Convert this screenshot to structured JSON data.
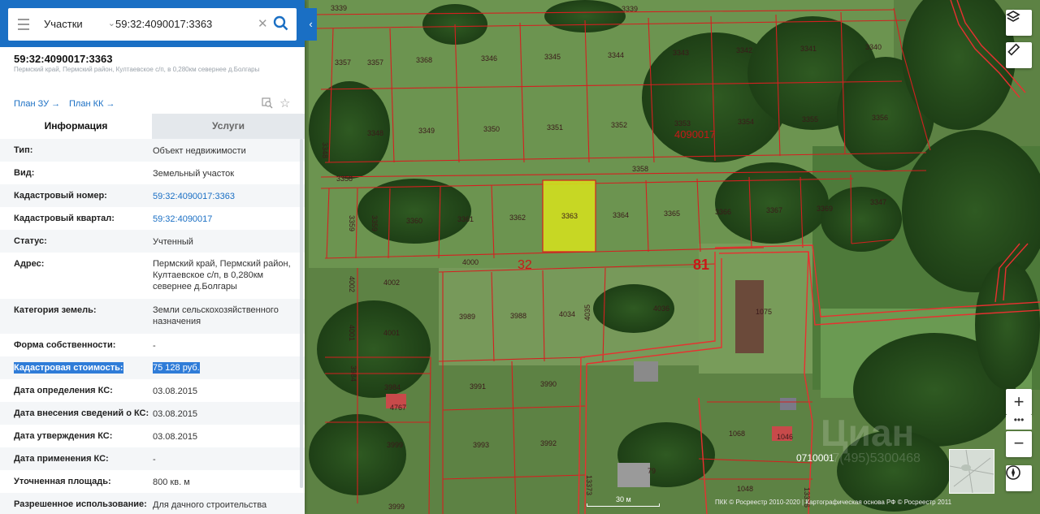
{
  "search": {
    "layer": "Участки",
    "value": "59:32:4090017:3363"
  },
  "object": {
    "title": "59:32:4090017:3363",
    "address": "Пермский край, Пермский район, Култаевское с/п, в 0,280км севернее д.Болгары",
    "plan_zu": "План ЗУ",
    "plan_kk": "План КК"
  },
  "tabs": {
    "info": "Информация",
    "services": "Услуги"
  },
  "info_rows": [
    {
      "key": "Тип:",
      "value": "Объект недвижимости"
    },
    {
      "key": "Вид:",
      "value": "Земельный участок"
    },
    {
      "key": "Кадастровый номер:",
      "value": "59:32:4090017:3363"
    },
    {
      "key": "Кадастровый квартал:",
      "value": "59:32:4090017"
    },
    {
      "key": "Статус:",
      "value": "Учтенный"
    },
    {
      "key": "Адрес:",
      "value": "Пермский край, Пермский район, Култаевское с/п, в 0,280км севернее д.Болгары"
    },
    {
      "key": "Категория земель:",
      "value": "Земли сельскохозяйственного назначения"
    },
    {
      "key": "Форма собственности:",
      "value": "-"
    },
    {
      "key": "Кадастровая стоимость:",
      "value": "75 128 руб."
    },
    {
      "key": "Дата определения КС:",
      "value": "03.08.2015"
    },
    {
      "key": "Дата внесения сведений о КС:",
      "value": "03.08.2015"
    },
    {
      "key": "Дата утверждения КС:",
      "value": "03.08.2015"
    },
    {
      "key": "Дата применения КС:",
      "value": "-"
    },
    {
      "key": "Уточненная площадь:",
      "value": "800 кв. м"
    },
    {
      "key": "Разрешенное использование:",
      "value": "Для дачного строительства"
    }
  ],
  "map": {
    "parcels": [
      "3339",
      "3357",
      "3357",
      "3368",
      "3346",
      "3345",
      "3344",
      "3343",
      "3342",
      "3341",
      "3340",
      "3348",
      "3348",
      "3349",
      "3350",
      "3351",
      "3352",
      "3353",
      "3354",
      "3355",
      "3356",
      "3358",
      "3358",
      "3359",
      "3359",
      "3360",
      "3361",
      "3362",
      "3363",
      "3364",
      "3365",
      "3366",
      "3367",
      "3369",
      "3347",
      "4000",
      "4002",
      "4002",
      "4001",
      "4001",
      "3989",
      "3988",
      "4034",
      "4035",
      "4036",
      "1075",
      "3984",
      "3984",
      "4767",
      "3991",
      "3990",
      "3993",
      "3992",
      "3999",
      "1068",
      "1046",
      "1048",
      "13373",
      "13376",
      "79"
    ],
    "quarter": "4090017",
    "big_labels": [
      "32",
      "81"
    ],
    "quarter2": "0710001",
    "highlight_color": "#d4e01e",
    "boundary_color": "#d42020"
  },
  "scale": "30 м",
  "attribution": "ПКК © Росреестр 2010-2020 | Картографическая основа РФ © Росреестр 2011",
  "watermark": "Циан",
  "watermark_sub": "+7(495)5300468"
}
